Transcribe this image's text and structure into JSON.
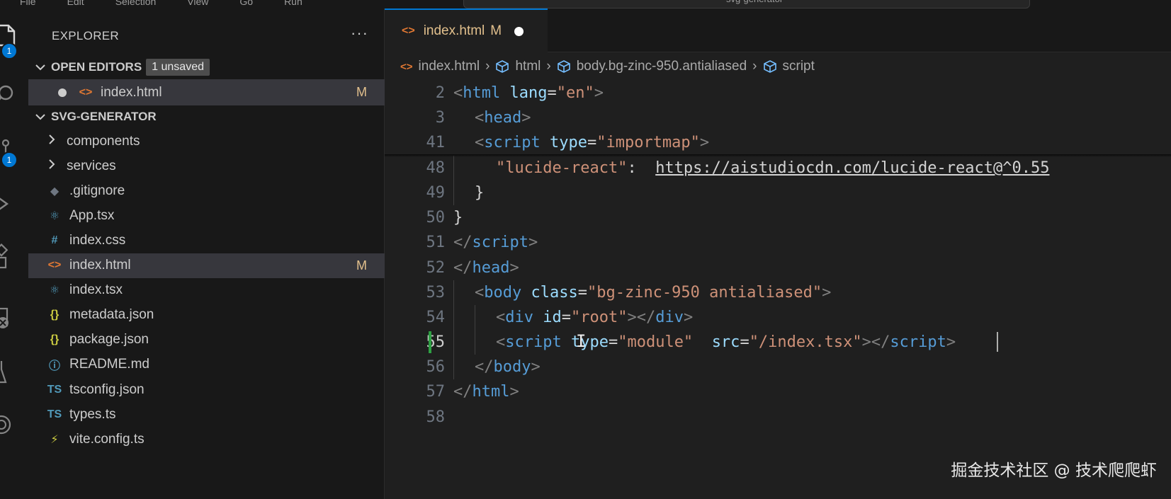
{
  "menu": [
    "File",
    "Edit",
    "Selection",
    "View",
    "Go",
    "Run"
  ],
  "command_center": "svg-generator",
  "activity_bar": {
    "items": [
      {
        "icon": "files-icon",
        "badge": "1"
      },
      {
        "icon": "search-icon"
      },
      {
        "icon": "source-control-icon",
        "badge": "1"
      },
      {
        "icon": "run-debug-icon"
      },
      {
        "icon": "extensions-icon"
      },
      {
        "icon": "remote-explorer-icon"
      },
      {
        "icon": "testing-icon"
      },
      {
        "icon": "openai-icon"
      }
    ]
  },
  "sidebar": {
    "title": "EXPLORER",
    "more": "···",
    "open_editors": {
      "label": "OPEN EDITORS",
      "badge": "1 unsaved",
      "files": [
        {
          "name": "index.html",
          "status": "M",
          "icon": "html-icon"
        }
      ]
    },
    "project": {
      "label": "SVG-GENERATOR",
      "items": [
        {
          "name": "components",
          "type": "folder"
        },
        {
          "name": "services",
          "type": "folder"
        },
        {
          "name": ".gitignore",
          "icon": "gitignore-icon",
          "icon_glyph": "◆",
          "color": "#6e7681"
        },
        {
          "name": "App.tsx",
          "icon": "react-icon",
          "icon_glyph": "⚛",
          "color": "#519aba"
        },
        {
          "name": "index.css",
          "icon": "css-icon",
          "icon_glyph": "#",
          "color": "#519aba"
        },
        {
          "name": "index.html",
          "icon": "html-icon",
          "icon_glyph": "<>",
          "color": "#e37933",
          "status": "M",
          "selected": true
        },
        {
          "name": "index.tsx",
          "icon": "react-icon",
          "icon_glyph": "⚛",
          "color": "#519aba"
        },
        {
          "name": "metadata.json",
          "icon": "json-icon",
          "icon_glyph": "{}",
          "color": "#cbcb41"
        },
        {
          "name": "package.json",
          "icon": "json-icon",
          "icon_glyph": "{}",
          "color": "#cbcb41"
        },
        {
          "name": "README.md",
          "icon": "info-icon",
          "icon_glyph": "ⓘ",
          "color": "#519aba"
        },
        {
          "name": "tsconfig.json",
          "icon": "tsconfig-icon",
          "icon_glyph": "TS",
          "color": "#519aba"
        },
        {
          "name": "types.ts",
          "icon": "typescript-icon",
          "icon_glyph": "TS",
          "color": "#519aba"
        },
        {
          "name": "vite.config.ts",
          "icon": "vite-icon",
          "icon_glyph": "⚡",
          "color": "#cbcb41"
        }
      ]
    }
  },
  "editor": {
    "tab": {
      "label": "index.html",
      "status": "M"
    },
    "breadcrumb": [
      "index.html",
      "html",
      "body.bg-zinc-950.antialiased",
      "script"
    ],
    "sticky_lines": [
      {
        "n": "2",
        "indent": 0,
        "tokens": [
          [
            "punc",
            "<"
          ],
          [
            "tag",
            "html"
          ],
          [
            "plain",
            " "
          ],
          [
            "attr",
            "lang"
          ],
          [
            "plain",
            "="
          ],
          [
            "str",
            "\"en\""
          ],
          [
            "punc",
            ">"
          ]
        ]
      },
      {
        "n": "3",
        "indent": 1,
        "tokens": [
          [
            "punc",
            "<"
          ],
          [
            "tag",
            "head"
          ],
          [
            "punc",
            ">"
          ]
        ]
      },
      {
        "n": "41",
        "indent": 1,
        "tokens": [
          [
            "punc",
            "<"
          ],
          [
            "tag",
            "script"
          ],
          [
            "plain",
            " "
          ],
          [
            "attr",
            "type"
          ],
          [
            "plain",
            "="
          ],
          [
            "str",
            "\"importmap\""
          ],
          [
            "punc",
            ">"
          ]
        ]
      }
    ],
    "lines": [
      {
        "n": "48",
        "indent": 2,
        "tokens": [
          [
            "str",
            "\"lucide-react\""
          ],
          [
            "plain",
            ":  "
          ],
          [
            "url",
            "https://aistudiocdn.com/lucide-react@^0.55"
          ]
        ]
      },
      {
        "n": "49",
        "indent": 1,
        "tokens": [
          [
            "plain",
            "}"
          ]
        ]
      },
      {
        "n": "50",
        "indent": 0,
        "tokens": [
          [
            "plain",
            "}"
          ]
        ]
      },
      {
        "n": "51",
        "indent": 0,
        "tokens": [
          [
            "punc",
            "</"
          ],
          [
            "tag",
            "script"
          ],
          [
            "punc",
            ">"
          ]
        ]
      },
      {
        "n": "52",
        "indent": 0,
        "tokens": [
          [
            "punc",
            "</"
          ],
          [
            "tag",
            "head"
          ],
          [
            "punc",
            ">"
          ]
        ]
      },
      {
        "n": "53",
        "indent": 1,
        "tokens": [
          [
            "punc",
            "<"
          ],
          [
            "tag",
            "body"
          ],
          [
            "plain",
            " "
          ],
          [
            "attr",
            "class"
          ],
          [
            "plain",
            "="
          ],
          [
            "str",
            "\"bg-zinc-950 antialiased\""
          ],
          [
            "punc",
            ">"
          ]
        ]
      },
      {
        "n": "54",
        "indent": 2,
        "tokens": [
          [
            "punc",
            "<"
          ],
          [
            "tag",
            "div"
          ],
          [
            "plain",
            " "
          ],
          [
            "attr",
            "id"
          ],
          [
            "plain",
            "="
          ],
          [
            "str",
            "\"root\""
          ],
          [
            "punc",
            "></"
          ],
          [
            "tag",
            "div"
          ],
          [
            "punc",
            ">"
          ]
        ]
      },
      {
        "n": "55",
        "indent": 2,
        "active": true,
        "tokens": [
          [
            "punc",
            "<"
          ],
          [
            "tag",
            "script"
          ],
          [
            "plain",
            " "
          ],
          [
            "attr",
            "type"
          ],
          [
            "plain",
            "="
          ],
          [
            "str",
            "\"module\""
          ],
          [
            "plain",
            "  "
          ],
          [
            "attr",
            "src"
          ],
          [
            "plain",
            "="
          ],
          [
            "str",
            "\"/index.tsx\""
          ],
          [
            "punc",
            "></"
          ],
          [
            "tag",
            "script"
          ],
          [
            "punc",
            ">"
          ]
        ]
      },
      {
        "n": "56",
        "indent": 1,
        "tokens": [
          [
            "punc",
            "</"
          ],
          [
            "tag",
            "body"
          ],
          [
            "punc",
            ">"
          ]
        ]
      },
      {
        "n": "57",
        "indent": 0,
        "tokens": [
          [
            "punc",
            "</"
          ],
          [
            "tag",
            "html"
          ],
          [
            "punc",
            ">"
          ]
        ]
      },
      {
        "n": "58",
        "indent": 0,
        "tokens": []
      }
    ]
  },
  "watermark": "掘金技术社区 @ 技术爬爬虾"
}
